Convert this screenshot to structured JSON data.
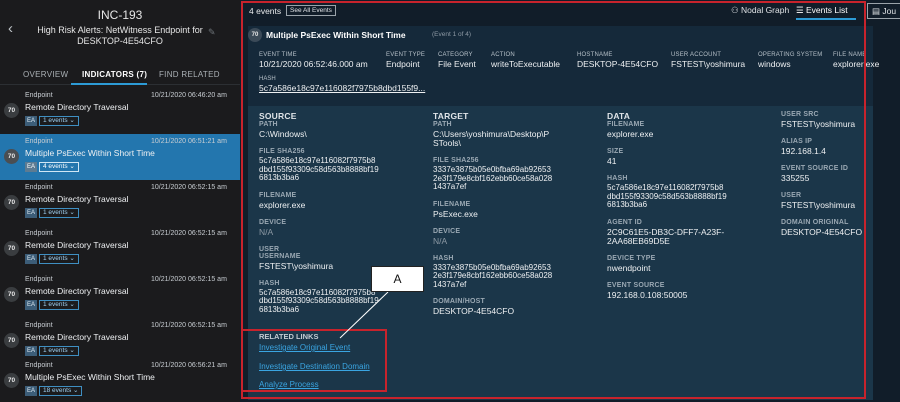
{
  "incident": {
    "id": "INC-193",
    "title": "High Risk Alerts: NetWitness Endpoint for DESKTOP-4E54CFO"
  },
  "left_tabs": [
    "OVERVIEW",
    "INDICATORS (7)",
    "FIND RELATED"
  ],
  "indicators": [
    {
      "score": "70",
      "source": "Endpoint",
      "time": "10/21/2020 06:46:20 am",
      "name": "Remote Directory Traversal",
      "ea": "EA",
      "events": "1 events"
    },
    {
      "score": "70",
      "source": "Endpoint",
      "time": "10/21/2020 06:51:21 am",
      "name": "Multiple PsExec Within Short Time",
      "ea": "EA",
      "events": "4 events"
    },
    {
      "score": "70",
      "source": "Endpoint",
      "time": "10/21/2020 06:52:15 am",
      "name": "Remote Directory Traversal",
      "ea": "EA",
      "events": "1 events"
    },
    {
      "score": "70",
      "source": "Endpoint",
      "time": "10/21/2020 06:52:15 am",
      "name": "Remote Directory Traversal",
      "ea": "EA",
      "events": "1 events"
    },
    {
      "score": "70",
      "source": "Endpoint",
      "time": "10/21/2020 06:52:15 am",
      "name": "Remote Directory Traversal",
      "ea": "EA",
      "events": "1 events"
    },
    {
      "score": "70",
      "source": "Endpoint",
      "time": "10/21/2020 06:52:15 am",
      "name": "Remote Directory Traversal",
      "ea": "EA",
      "events": "1 events"
    },
    {
      "score": "70",
      "source": "Endpoint",
      "time": "10/21/2020 06:56:21 am",
      "name": "Multiple PsExec Within Short Time",
      "ea": "EA",
      "events": "18 events"
    }
  ],
  "toolbar": {
    "events_count": "4 events",
    "see_all": "See All Events",
    "nodal_graph": "Nodal Graph",
    "events_list": "Events List",
    "journal": "Jou"
  },
  "event": {
    "score": "70",
    "title": "Multiple PsExec Within Short Time",
    "subtitle": "(Event 1 of 4)",
    "meta": [
      {
        "label": "EVENT TIME",
        "value": "10/21/2020 06:52:46.000 am"
      },
      {
        "label": "EVENT TYPE",
        "value": "Endpoint"
      },
      {
        "label": "CATEGORY",
        "value": "File Event"
      },
      {
        "label": "ACTION",
        "value": "writeToExecutable"
      },
      {
        "label": "HOSTNAME",
        "value": "DESKTOP-4E54CFO"
      },
      {
        "label": "USER ACCOUNT",
        "value": "FSTEST\\yoshimura"
      },
      {
        "label": "OPERATING SYSTEM",
        "value": "windows"
      },
      {
        "label": "FILE NAME",
        "value": "explorer.exe"
      }
    ],
    "hash_label": "HASH",
    "hash_value": "5c7a586e18c97e116082f7975b8dbd155f9..."
  },
  "source": {
    "heading": "SOURCE",
    "path_label": "PATH",
    "path": "C:\\Windows\\",
    "sha_label": "FILE SHA256",
    "sha": "5c7a586e18c97e116082f7975b8dbd155f93309c58d563b8888bf196813b3ba6",
    "filename_label": "FILENAME",
    "filename": "explorer.exe",
    "device_heading": "DEVICE",
    "device": "N/A",
    "user_heading": "USER",
    "username_label": "USERNAME",
    "username": "FSTEST\\yoshimura",
    "hash_label": "HASH",
    "hash": "5c7a586e18c97e116082f7975b8dbd155f93309c58d563b8888bf196813b3ba6"
  },
  "target": {
    "heading": "TARGET",
    "path_label": "PATH",
    "path": "C:\\Users\\yoshimura\\Desktop\\PSTools\\",
    "sha_label": "FILE SHA256",
    "sha": "3337e3875b05e0bfba69ab926532e3f179e8cbf162ebb60ce58a0281437a7ef",
    "filename_label": "FILENAME",
    "filename": "PsExec.exe",
    "device_heading": "DEVICE",
    "device": "N/A",
    "hash_label": "HASH",
    "hash": "3337e3875b05e0bfba69ab926532e3f179e8cbf162ebb60ce58a0281437a7ef",
    "domain_label": "DOMAIN/HOST",
    "domain": "DESKTOP-4E54CFO"
  },
  "data": {
    "heading": "DATA",
    "filename_label": "FILENAME",
    "filename": "explorer.exe",
    "size_label": "SIZE",
    "size": "41",
    "hash_label": "HASH",
    "hash": "5c7a586e18c97e116082f7975b8dbd155f93309c58d563b8888bf196813b3ba6",
    "agent_label": "AGENT ID",
    "agent": "2C9C61E5-DB3C-DFF7-A23F-2AA68EB69D5E",
    "device_type_label": "DEVICE TYPE",
    "device_type": "nwendpoint",
    "event_source_label": "EVENT SOURCE",
    "event_source": "192.168.0.108:50005"
  },
  "extra": {
    "user_src_label": "USER SRC",
    "user_src": "FSTEST\\yoshimura",
    "alias_ip_label": "ALIAS IP",
    "alias_ip": "192.168.1.4",
    "event_source_id_label": "EVENT SOURCE ID",
    "event_source_id": "335255",
    "user_label": "USER",
    "user": "FSTEST\\yoshimura",
    "domain_original_label": "DOMAIN ORIGINAL",
    "domain_original": "DESKTOP-4E54CFO"
  },
  "related_links": {
    "heading": "RELATED LINKS",
    "links": [
      "Investigate Original Event",
      "Investigate Destination Domain",
      "Analyze Process"
    ]
  },
  "callout": "A",
  "colors": {
    "accent": "#2d9bd6",
    "highlight": "#c8232c",
    "selected_row": "#2376ae",
    "link": "#3aa5e2"
  }
}
